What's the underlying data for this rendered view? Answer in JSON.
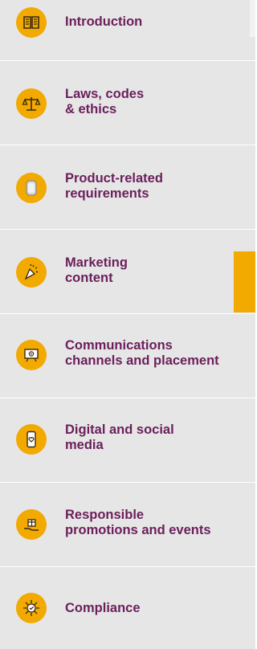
{
  "nav": {
    "items": [
      {
        "label": "Introduction",
        "icon": "book-icon"
      },
      {
        "label": "Laws, codes\n& ethics",
        "icon": "scales-icon"
      },
      {
        "label": "Product-related\nrequirements",
        "icon": "bottle-icon"
      },
      {
        "label": "Marketing\ncontent",
        "icon": "party-popper-icon"
      },
      {
        "label": "Communications\nchannels and placement",
        "icon": "screen-icon"
      },
      {
        "label": "Digital and social\nmedia",
        "icon": "phone-heart-icon"
      },
      {
        "label": "Responsible\npromotions and events",
        "icon": "gift-hand-icon"
      },
      {
        "label": "Compliance",
        "icon": "compliance-icon"
      }
    ],
    "active_index": 3
  },
  "colors": {
    "background": "#e6e6e6",
    "accent": "#f2a900",
    "label": "#6b1f5b",
    "divider": "#ffffff"
  }
}
